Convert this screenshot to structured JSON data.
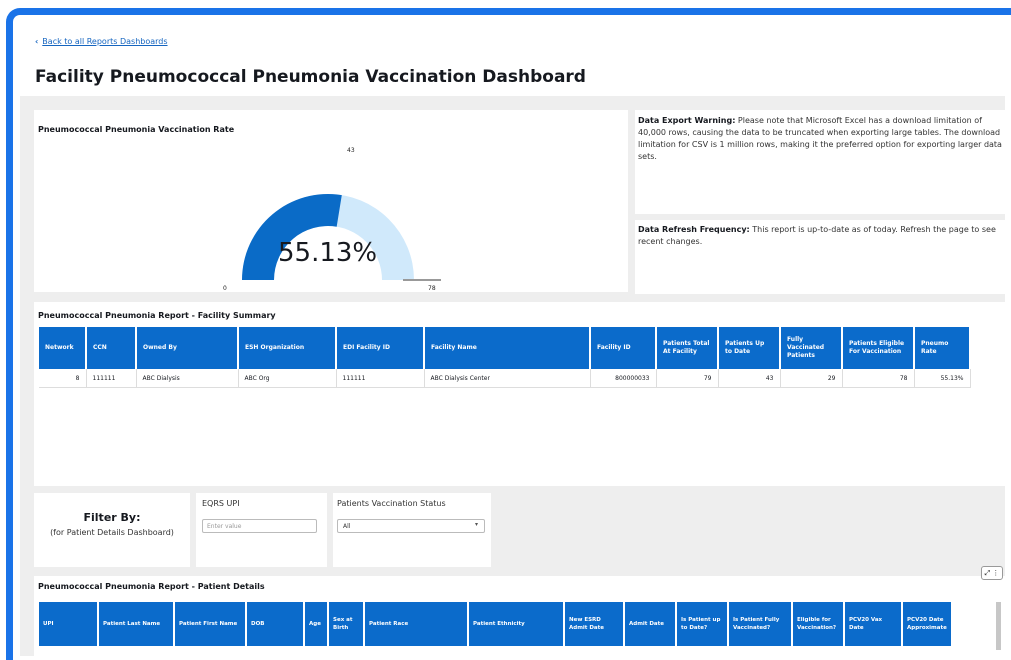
{
  "header": {
    "back_link": "Back to all Reports Dashboards",
    "title": "Facility Pneumococcal Pneumonia Vaccination Dashboard"
  },
  "colors": {
    "accent": "#0b6bcb",
    "gauge_fill": "#0a6bc7",
    "gauge_track": "#d0e9fb",
    "frame": "#1a73e8"
  },
  "gauge": {
    "title": "Pneumococcal Pneumonia Vaccination Rate",
    "value": 43,
    "min_label": "0",
    "max": 78,
    "max_label": "78",
    "value_label": "43",
    "percent": "55.13%"
  },
  "info": {
    "export_title": "Data Export Warning:",
    "export_text": " Please note that Microsoft Excel has a download limitation of 40,000 rows, causing the data to be truncated when exporting large tables. The download limitation for CSV is 1 million rows, making it the preferred option for exporting larger data sets.",
    "refresh_title": "Data Refresh Frequency:",
    "refresh_text": " This report is up-to-date as of today.  Refresh the page to see recent changes."
  },
  "summary": {
    "title": "Pneumococcal Pneumonia Report - Facility Summary",
    "columns": [
      "Network",
      "CCN",
      "Owned By",
      "ESH Organization",
      "EDI Facility ID",
      "Facility Name",
      "Facility ID",
      "Patients Total At Facility",
      "Patients Up to Date",
      "Fully Vaccinated Patients",
      "Patients Eligible For Vaccination",
      "Pneumo Rate"
    ],
    "row": [
      "8",
      "111111",
      "ABC Dialysis",
      "ABC Org",
      "111111",
      "ABC Dialysis Center",
      "800000033",
      "79",
      "43",
      "29",
      "78",
      "55.13%"
    ]
  },
  "filter": {
    "heading": "Filter By:",
    "sub": "(for Patient Details Dashboard)",
    "upi_label": "EQRS UPI",
    "upi_placeholder": "Enter value",
    "status_label": "Patients Vaccination Status",
    "status_value": "All",
    "status_arrow": "▾"
  },
  "details": {
    "title": "Pneumococcal Pneumonia Report - Patient Details",
    "expand_icon": "⤢ ⋮",
    "columns": [
      "UPI",
      "Patient Last Name",
      "Patient First Name",
      "DOB",
      "Age",
      "Sex at Birth",
      "Patient Race",
      "Patient Ethnicity",
      "New ESRD Admit Date",
      "Admit Date",
      "Is Patient up to Date?",
      "Is Patient Fully Vaccinated?",
      "Eligible for Vaccination?",
      "PCV20 Vax Date",
      "PCV20 Date Approximate"
    ]
  }
}
